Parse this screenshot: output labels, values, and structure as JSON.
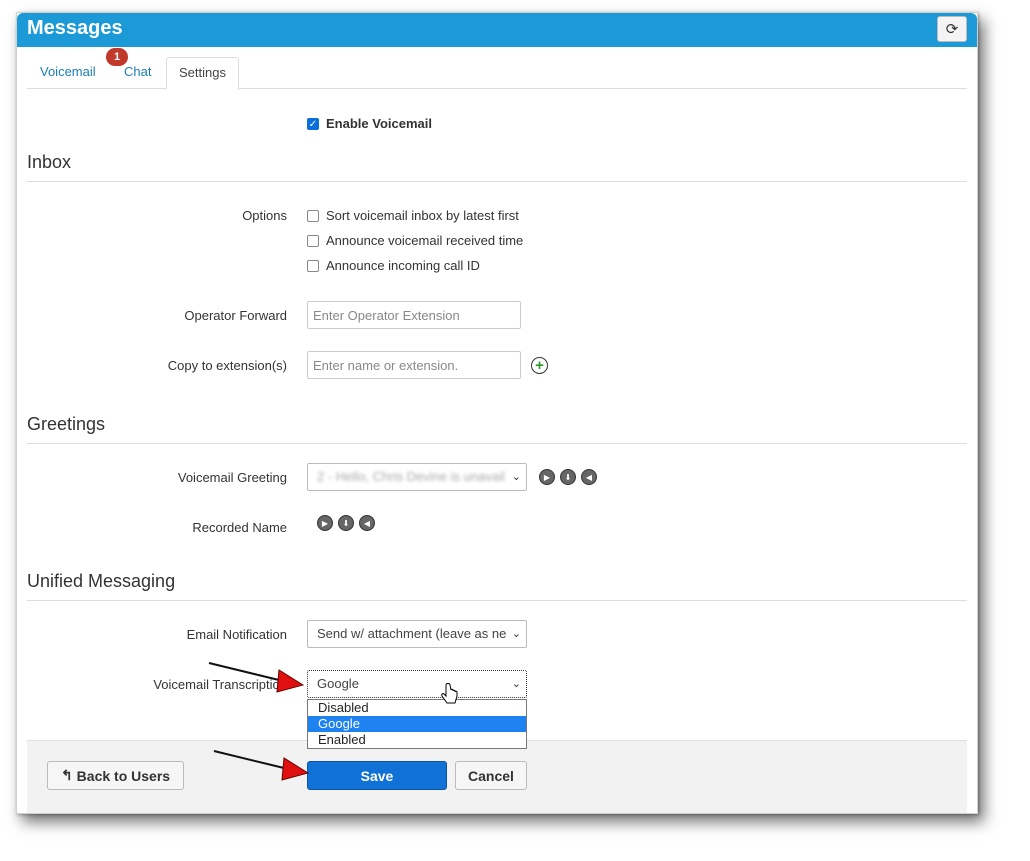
{
  "header": {
    "title": "Messages",
    "refresh_icon": "refresh-icon"
  },
  "tabs": [
    {
      "label": "Voicemail",
      "badge": "1"
    },
    {
      "label": "Chat"
    },
    {
      "label": "Settings",
      "active": true
    }
  ],
  "enable_voicemail": {
    "label": "Enable Voicemail",
    "checked": true
  },
  "inbox": {
    "heading": "Inbox",
    "options_label": "Options",
    "options": [
      {
        "label": "Sort voicemail inbox by latest first",
        "checked": false
      },
      {
        "label": "Announce voicemail received time",
        "checked": false
      },
      {
        "label": "Announce incoming call ID",
        "checked": false
      }
    ],
    "operator_forward_label": "Operator Forward",
    "operator_forward_placeholder": "Enter Operator Extension",
    "copy_label": "Copy to extension(s)",
    "copy_placeholder": "Enter name or extension."
  },
  "greetings": {
    "heading": "Greetings",
    "voicemail_greeting_label": "Voicemail Greeting",
    "voicemail_greeting_value": "2 - Hello, Chris Devine is unavail",
    "recorded_name_label": "Recorded Name"
  },
  "unified": {
    "heading": "Unified Messaging",
    "email_label": "Email Notification",
    "email_value": "Send w/ attachment (leave as ne",
    "transcription_label": "Voicemail Transcription",
    "transcription_value": "Google",
    "transcription_options": [
      "Disabled",
      "Google",
      "Enabled"
    ]
  },
  "footer": {
    "back_label": "Back to Users",
    "save_label": "Save",
    "cancel_label": "Cancel"
  },
  "colors": {
    "accent": "#1c9ad8",
    "primary_button": "#1071d6",
    "badge": "#c0392b",
    "annotation_arrow": "#e01010"
  }
}
